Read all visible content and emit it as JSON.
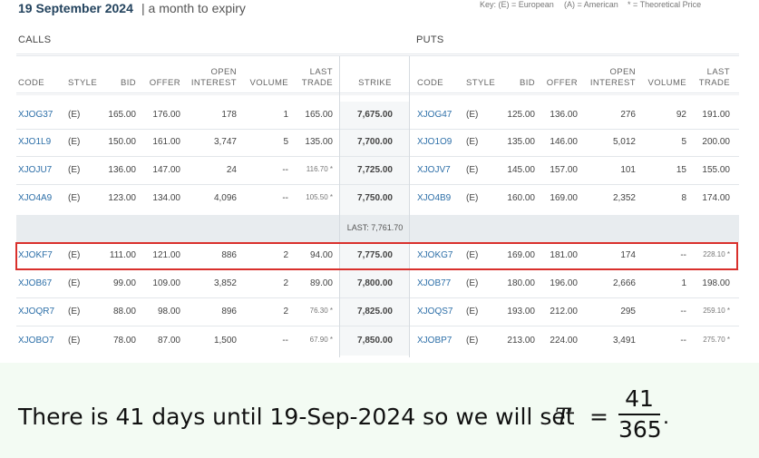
{
  "header": {
    "expiry_date": "19 September 2024",
    "expiry_sub": "| a month to expiry",
    "key_label": "Key: (E) = European",
    "key_american": "(A) = American",
    "key_theoretical": "* = Theoretical Price"
  },
  "sections": {
    "calls": "CALLS",
    "puts": "PUTS"
  },
  "columns": {
    "code": "CODE",
    "style": "STYLE",
    "bid": "BID",
    "offer": "OFFER",
    "open_interest_1": "OPEN",
    "open_interest_2": "INTEREST",
    "volume": "VOLUME",
    "last_trade_1": "LAST",
    "last_trade_2": "TRADE",
    "strike": "STRIKE"
  },
  "last_price": "LAST: 7,761.70",
  "rows": [
    {
      "c_code": "XJOG37",
      "c_style": "(E)",
      "c_bid": "165.00",
      "c_offer": "176.00",
      "c_oi": "178",
      "c_vol": "1",
      "c_last": "165.00",
      "strike": "7,675.00",
      "p_code": "XJOG47",
      "p_style": "(E)",
      "p_bid": "125.00",
      "p_offer": "136.00",
      "p_oi": "276",
      "p_vol": "92",
      "p_last": "191.00"
    },
    {
      "c_code": "XJO1L9",
      "c_style": "(E)",
      "c_bid": "150.00",
      "c_offer": "161.00",
      "c_oi": "3,747",
      "c_vol": "5",
      "c_last": "135.00",
      "strike": "7,700.00",
      "p_code": "XJO1O9",
      "p_style": "(E)",
      "p_bid": "135.00",
      "p_offer": "146.00",
      "p_oi": "5,012",
      "p_vol": "5",
      "p_last": "200.00"
    },
    {
      "c_code": "XJOJU7",
      "c_style": "(E)",
      "c_bid": "136.00",
      "c_offer": "147.00",
      "c_oi": "24",
      "c_vol": "--",
      "c_last": "116.70 *",
      "strike": "7,725.00",
      "p_code": "XJOJV7",
      "p_style": "(E)",
      "p_bid": "145.00",
      "p_offer": "157.00",
      "p_oi": "101",
      "p_vol": "15",
      "p_last": "155.00"
    },
    {
      "c_code": "XJO4A9",
      "c_style": "(E)",
      "c_bid": "123.00",
      "c_offer": "134.00",
      "c_oi": "4,096",
      "c_vol": "--",
      "c_last": "105.50 *",
      "strike": "7,750.00",
      "p_code": "XJO4B9",
      "p_style": "(E)",
      "p_bid": "160.00",
      "p_offer": "169.00",
      "p_oi": "2,352",
      "p_vol": "8",
      "p_last": "174.00"
    },
    {
      "c_code": "XJOKF7",
      "c_style": "(E)",
      "c_bid": "111.00",
      "c_offer": "121.00",
      "c_oi": "886",
      "c_vol": "2",
      "c_last": "94.00",
      "strike": "7,775.00",
      "p_code": "XJOKG7",
      "p_style": "(E)",
      "p_bid": "169.00",
      "p_offer": "181.00",
      "p_oi": "174",
      "p_vol": "--",
      "p_last": "228.10 *"
    },
    {
      "c_code": "XJOB67",
      "c_style": "(E)",
      "c_bid": "99.00",
      "c_offer": "109.00",
      "c_oi": "3,852",
      "c_vol": "2",
      "c_last": "89.00",
      "strike": "7,800.00",
      "p_code": "XJOB77",
      "p_style": "(E)",
      "p_bid": "180.00",
      "p_offer": "196.00",
      "p_oi": "2,666",
      "p_vol": "1",
      "p_last": "198.00"
    },
    {
      "c_code": "XJOQR7",
      "c_style": "(E)",
      "c_bid": "88.00",
      "c_offer": "98.00",
      "c_oi": "896",
      "c_vol": "2",
      "c_last": "76.30 *",
      "strike": "7,825.00",
      "p_code": "XJOQS7",
      "p_style": "(E)",
      "p_bid": "193.00",
      "p_offer": "212.00",
      "p_oi": "295",
      "p_vol": "--",
      "p_last": "259.10 *"
    },
    {
      "c_code": "XJOBO7",
      "c_style": "(E)",
      "c_bid": "78.00",
      "c_offer": "87.00",
      "c_oi": "1,500",
      "c_vol": "--",
      "c_last": "67.90 *",
      "strike": "7,850.00",
      "p_code": "XJOBP7",
      "p_style": "(E)",
      "p_bid": "213.00",
      "p_offer": "224.00",
      "p_oi": "3,491",
      "p_vol": "--",
      "p_last": "275.70 *"
    }
  ],
  "note": {
    "text": "There is 41 days until 19-Sep-2024 so we will set",
    "var": "T",
    "eq": "=",
    "numerator": "41",
    "denominator": "365",
    "period": "."
  },
  "colors": {
    "code_link": "#2d6fa8",
    "highlight": "#d9302c",
    "title": "#23435e"
  }
}
